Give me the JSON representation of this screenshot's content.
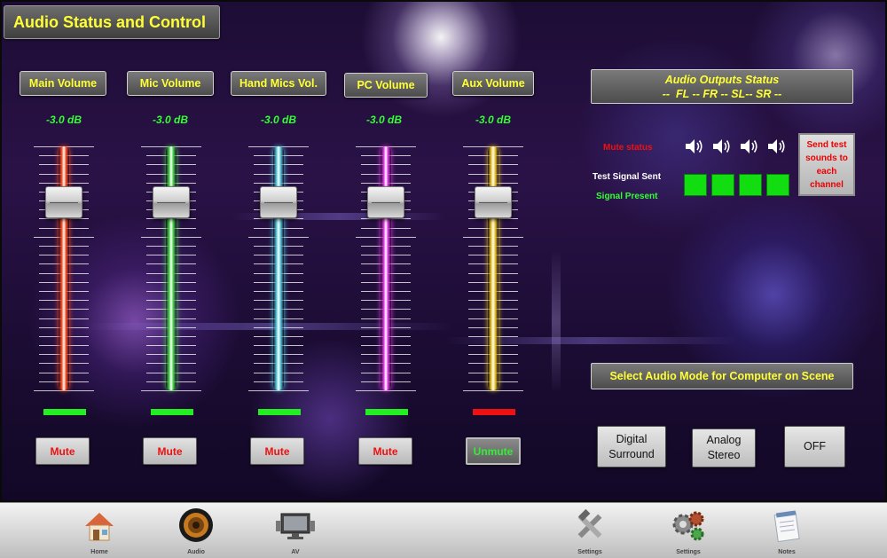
{
  "header": {
    "title": "Audio Status and Control"
  },
  "channels": [
    {
      "label": "Main Volume",
      "db": "-3.0 dB",
      "color": "#ff4a1a",
      "level_color": "#22ee22",
      "button": "Mute",
      "button_color": "#ee1111",
      "level_percent": 81
    },
    {
      "label": "Mic Volume",
      "db": "-3.0 dB",
      "color": "#3fcf3f",
      "level_color": "#22ee22",
      "button": "Mute",
      "button_color": "#ee1111",
      "level_percent": 81
    },
    {
      "label": "Hand Mics Vol.",
      "db": "-3.0 dB",
      "color": "#4fc6d6",
      "level_color": "#22ee22",
      "button": "Mute",
      "button_color": "#ee1111",
      "level_percent": 81
    },
    {
      "label": "PC Volume",
      "db": "-3.0 dB",
      "color": "#dd33dd",
      "level_color": "#22ee22",
      "button": "Mute",
      "button_color": "#ee1111",
      "level_percent": 81
    },
    {
      "label": "Aux Volume",
      "db": "-3.0 dB",
      "color": "#e8c21a",
      "level_color": "#ee1111",
      "button": "Unmute",
      "button_color": "#33ee33",
      "level_percent": 81
    }
  ],
  "outputs": {
    "title": "Audio Outputs Status",
    "subtitle": "--  FL -- FR -- SL-- SR --",
    "mute_status_label": "Mute status",
    "test_signal_label": "Test Signal Sent",
    "signal_present_label": "Signal Present",
    "speaker_icon": "speaker-icon",
    "signal_color": "#11dd11",
    "test_button": "Send test sounds to each channel"
  },
  "mode": {
    "title": "Select Audio Mode for Computer on Scene",
    "buttons": [
      {
        "line1": "Digital",
        "line2": "Surround",
        "active": false
      },
      {
        "line1": "Analog",
        "line2": "Stereo",
        "active": true
      },
      {
        "line1": "OFF",
        "line2": "",
        "active": false
      }
    ]
  },
  "nav": [
    {
      "label": "Home",
      "icon": "home-icon"
    },
    {
      "label": "Audio",
      "icon": "speaker-icon"
    },
    {
      "label": "AV",
      "icon": "tv-icon"
    },
    {
      "label": "Settings",
      "icon": "tools-icon"
    },
    {
      "label": "Settings",
      "icon": "gears-icon"
    },
    {
      "label": "Notes",
      "icon": "notepad-icon"
    }
  ]
}
